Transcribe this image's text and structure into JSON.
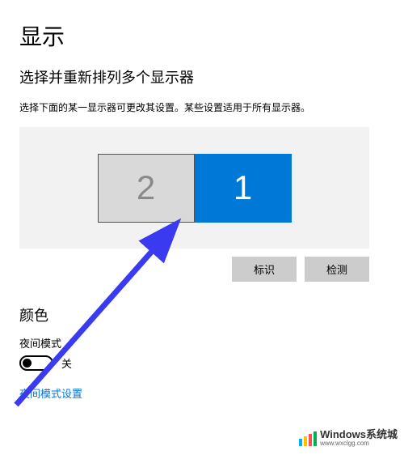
{
  "page": {
    "title": "显示",
    "section_title": "选择并重新排列多个显示器",
    "description": "选择下面的某一显示器可更改其设置。某些设置适用于所有显示器。"
  },
  "displays": {
    "monitor2": "2",
    "monitor1": "1"
  },
  "buttons": {
    "identify": "标识",
    "detect": "检测"
  },
  "color": {
    "title": "颜色",
    "night_light_label": "夜间模式",
    "toggle_state": "关",
    "settings_link": "夜间模式设置"
  },
  "watermark": {
    "title": "Windows系统城",
    "url": "www.wxclgg.com"
  }
}
